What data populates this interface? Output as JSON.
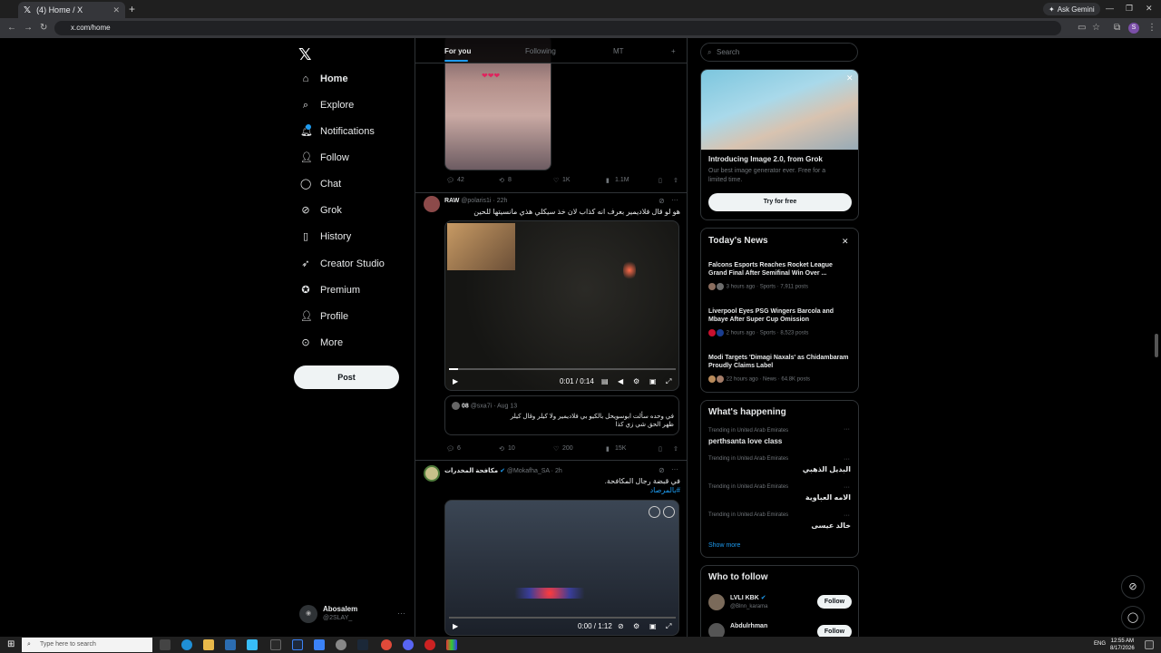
{
  "browser": {
    "tab_title": "(4) Home / X",
    "tab_close": "✕",
    "new_tab": "+",
    "url": "x.com/home",
    "ask_gemini": "Ask Gemini",
    "profile_initial": "S"
  },
  "sidebar": {
    "items": [
      {
        "label": "Home",
        "icon": "home-icon"
      },
      {
        "label": "Explore",
        "icon": "search-icon"
      },
      {
        "label": "Notifications",
        "icon": "bell-icon"
      },
      {
        "label": "Follow",
        "icon": "person-plus-icon"
      },
      {
        "label": "Chat",
        "icon": "chat-icon"
      },
      {
        "label": "Grok",
        "icon": "grok-icon"
      },
      {
        "label": "History",
        "icon": "bookmark-icon"
      },
      {
        "label": "Creator Studio",
        "icon": "rocket-icon"
      },
      {
        "label": "Premium",
        "icon": "verified-icon"
      },
      {
        "label": "Profile",
        "icon": "person-icon"
      },
      {
        "label": "More",
        "icon": "more-circle-icon"
      }
    ],
    "post_label": "Post",
    "account": {
      "name": "Abosalem",
      "handle": "@2SLAY_"
    }
  },
  "timeline": {
    "tabs": [
      {
        "label": "For you",
        "active": true
      },
      {
        "label": "Following",
        "active": false
      },
      {
        "label": "MT",
        "active": false
      }
    ],
    "tab_plus": "+",
    "tweet1_actions": {
      "replies": "42",
      "reposts": "8",
      "likes": "1K",
      "views": "1.1M"
    },
    "tweet2": {
      "name": "RAW",
      "handle": "@polaris1i",
      "time": "22h",
      "text": "هو لو قال فلاديمير بعرف انه كذاب لان خذ سيكلي هذي مانسيتها للحين",
      "video_time": "0:01 / 0:14",
      "quote": {
        "name": "08",
        "handle": "@sxa7i",
        "time": "Aug 13",
        "text": "في وحده سألت ابوسويحل بالكيو بي فلاديمير ولا كيلر وقال كيلر ظهر الحق شي زي كذا"
      },
      "actions": {
        "replies": "6",
        "reposts": "10",
        "likes": "200",
        "views": "15K"
      }
    },
    "tweet3": {
      "name": "مكافحة المخدرات",
      "handle": "@Mokafha_SA",
      "time": "2h",
      "text": "في قبضة رجال المكافحة.",
      "hashtag": "#بالمرصاد",
      "video_time": "0:00 / 1:12"
    }
  },
  "right": {
    "search_placeholder": "Search",
    "grok": {
      "title": "Introducing Image 2.0, from Grok",
      "desc": "Our best image generator ever. Free for a limited time.",
      "button": "Try for free"
    },
    "news": {
      "title": "Today's News",
      "items": [
        {
          "headline": "Falcons Esports Reaches Rocket League Grand Final After Semifinal Win Over ...",
          "meta": "3 hours ago · Sports · 7,911 posts"
        },
        {
          "headline": "Liverpool Eyes PSG Wingers Barcola and Mbaye After Super Cup Omission",
          "meta": "2 hours ago · Sports · 8,523 posts"
        },
        {
          "headline": "Modi Targets 'Dimagi Naxals' as Chidambaram Proudly Claims Label",
          "meta": "22 hours ago · News · 64.8K posts"
        }
      ]
    },
    "happening": {
      "title": "What's happening",
      "trends": [
        {
          "label": "Trending in United Arab Emirates",
          "name": "perthsanta love class",
          "rtl": false
        },
        {
          "label": "Trending in United Arab Emirates",
          "name": "البديل الذهبي",
          "rtl": true
        },
        {
          "label": "Trending in United Arab Emirates",
          "name": "الامه العباوية",
          "rtl": true
        },
        {
          "label": "Trending in United Arab Emirates",
          "name": "خالد عيسى",
          "rtl": true
        }
      ],
      "show_more": "Show more"
    },
    "who_to_follow": {
      "title": "Who to follow",
      "users": [
        {
          "name": "LVLI KBK",
          "handle": "@Blnn_karama",
          "button": "Follow"
        },
        {
          "name": "Abdulrhman",
          "handle": "",
          "button": "Follow"
        }
      ]
    }
  },
  "taskbar": {
    "search_placeholder": "Type here to search",
    "lang": "ENG",
    "time": "12:55 AM",
    "date": "8/17/2026"
  }
}
